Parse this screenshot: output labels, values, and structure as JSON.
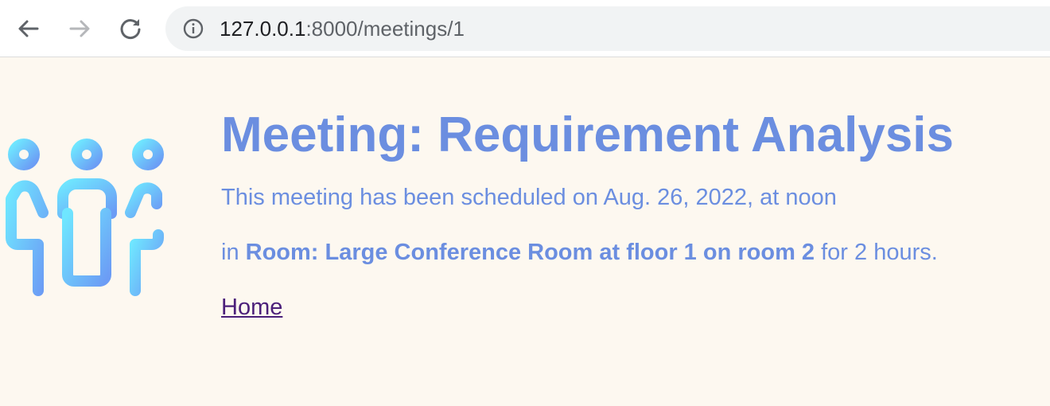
{
  "browser": {
    "url_host": "127.0.0.1",
    "url_rest": ":8000/meetings/1",
    "icons": {
      "back": "arrow-left-icon",
      "forward": "arrow-right-icon",
      "reload": "reload-icon",
      "site_info": "info-icon"
    }
  },
  "page": {
    "logo_icon": "meeting-people-icon",
    "title": "Meeting: Requirement Analysis",
    "schedule_text": "This meeting has been scheduled on Aug. 26, 2022, at noon",
    "location_prefix": "in",
    "room": "Room: Large Conference Room at floor 1 on room 2",
    "duration_text": "for 2 hours.",
    "home_link": "Home"
  },
  "colors": {
    "background": "#fdf8f0",
    "text": "#6b8ee0",
    "link": "#4b1f7a",
    "logo_gradient_start": "#6fe6ff",
    "logo_gradient_end": "#6c9cf5"
  }
}
